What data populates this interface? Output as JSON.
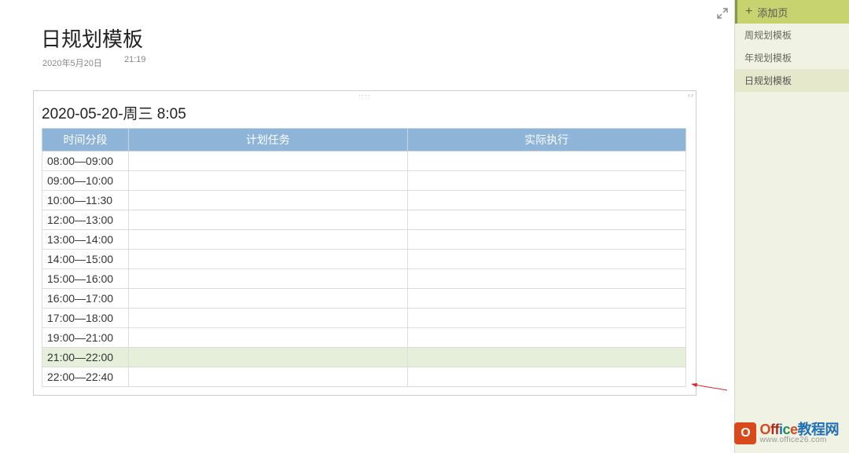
{
  "page": {
    "title": "日规划模板",
    "date": "2020年5月20日",
    "time": "21:19"
  },
  "table": {
    "title": "2020-05-20-周三 8:05",
    "headers": [
      "时间分段",
      "计划任务",
      "实际执行"
    ],
    "rows": [
      {
        "slot": "08:00—09:00",
        "plan": "",
        "actual": "",
        "highlight": false
      },
      {
        "slot": "09:00—10:00",
        "plan": "",
        "actual": "",
        "highlight": false
      },
      {
        "slot": "10:00—11:30",
        "plan": "",
        "actual": "",
        "highlight": false
      },
      {
        "slot": "12:00—13:00",
        "plan": "",
        "actual": "",
        "highlight": false
      },
      {
        "slot": "13:00—14:00",
        "plan": "",
        "actual": "",
        "highlight": false
      },
      {
        "slot": "14:00—15:00",
        "plan": "",
        "actual": "",
        "highlight": false
      },
      {
        "slot": "15:00—16:00",
        "plan": "",
        "actual": "",
        "highlight": false
      },
      {
        "slot": "16:00—17:00",
        "plan": "",
        "actual": "",
        "highlight": false
      },
      {
        "slot": "17:00—18:00",
        "plan": "",
        "actual": "",
        "highlight": false
      },
      {
        "slot": "19:00—21:00",
        "plan": "",
        "actual": "",
        "highlight": false
      },
      {
        "slot": "21:00—22:00",
        "plan": "",
        "actual": "",
        "highlight": true
      },
      {
        "slot": "22:00—22:40",
        "plan": "",
        "actual": "",
        "highlight": false
      }
    ]
  },
  "sidebar": {
    "add_label": "添加页",
    "items": [
      {
        "label": "周规划模板",
        "selected": false
      },
      {
        "label": "年规划模板",
        "selected": false
      },
      {
        "label": "日规划模板",
        "selected": true
      }
    ]
  },
  "watermark": {
    "text": "Office教程网",
    "url": "www.office26.com"
  }
}
